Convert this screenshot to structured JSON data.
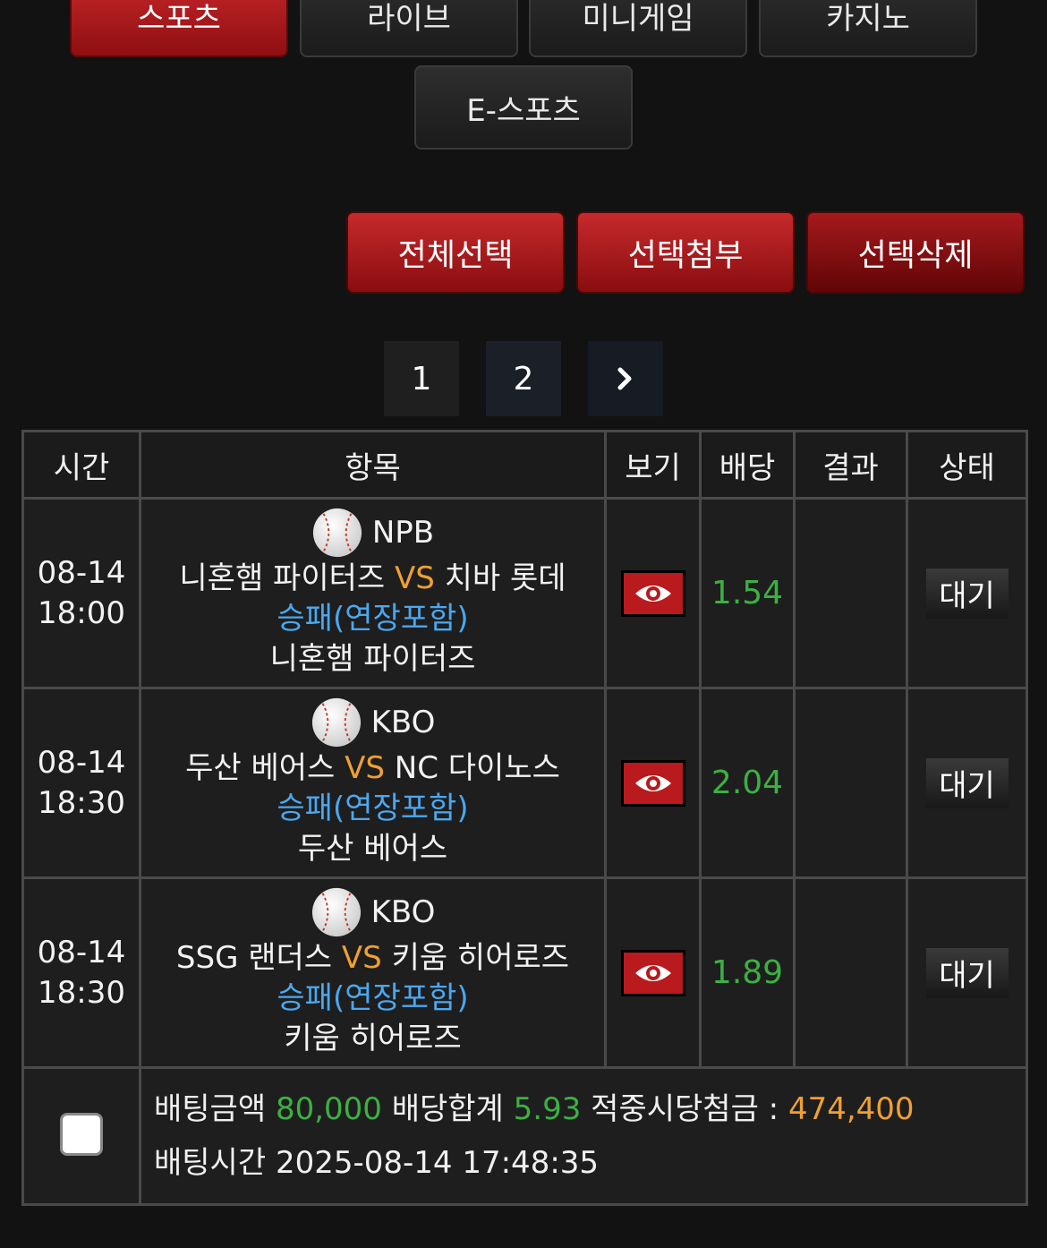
{
  "tabs": [
    "스포츠",
    "라이브",
    "미니게임",
    "카지노",
    "E-스포츠"
  ],
  "actions": {
    "select_all": "전체선택",
    "attach_selected": "선택첨부",
    "delete_selected": "선택삭제"
  },
  "pagination": {
    "pages": [
      "1",
      "2"
    ],
    "next_icon": "chevron-right-icon"
  },
  "table": {
    "headers": [
      "시간",
      "항목",
      "보기",
      "배당",
      "결과",
      "상태"
    ],
    "vs_label": "VS",
    "rows": [
      {
        "date": "08-14",
        "time": "18:00",
        "league": "NPB",
        "home": "니혼햄 파이터즈",
        "away": "치바 롯데",
        "market": "승패(연장포함)",
        "pick": "니혼햄 파이터즈",
        "odds": "1.54",
        "result": "",
        "status": "대기"
      },
      {
        "date": "08-14",
        "time": "18:30",
        "league": "KBO",
        "home": "두산 베어스",
        "away": "NC 다이노스",
        "market": "승패(연장포함)",
        "pick": "두산 베어스",
        "odds": "2.04",
        "result": "",
        "status": "대기"
      },
      {
        "date": "08-14",
        "time": "18:30",
        "league": "KBO",
        "home": "SSG 랜더스",
        "away": "키움 히어로즈",
        "market": "승패(연장포함)",
        "pick": "키움 히어로즈",
        "odds": "1.89",
        "result": "",
        "status": "대기"
      }
    ]
  },
  "summary": {
    "bet_amount_label": "배팅금액",
    "bet_amount": "80,000",
    "odds_total_label": "배당합계",
    "odds_total": "5.93",
    "payout_label": "적중시당첨금 :",
    "payout": "474,400",
    "bet_time_label": "배팅시간",
    "bet_time": "2025-08-14 17:48:35"
  },
  "colors": {
    "accent_red": "#b81a1d",
    "odds_green": "#3cb043",
    "vs_orange": "#f0a030",
    "market_blue": "#4aa8f0"
  }
}
